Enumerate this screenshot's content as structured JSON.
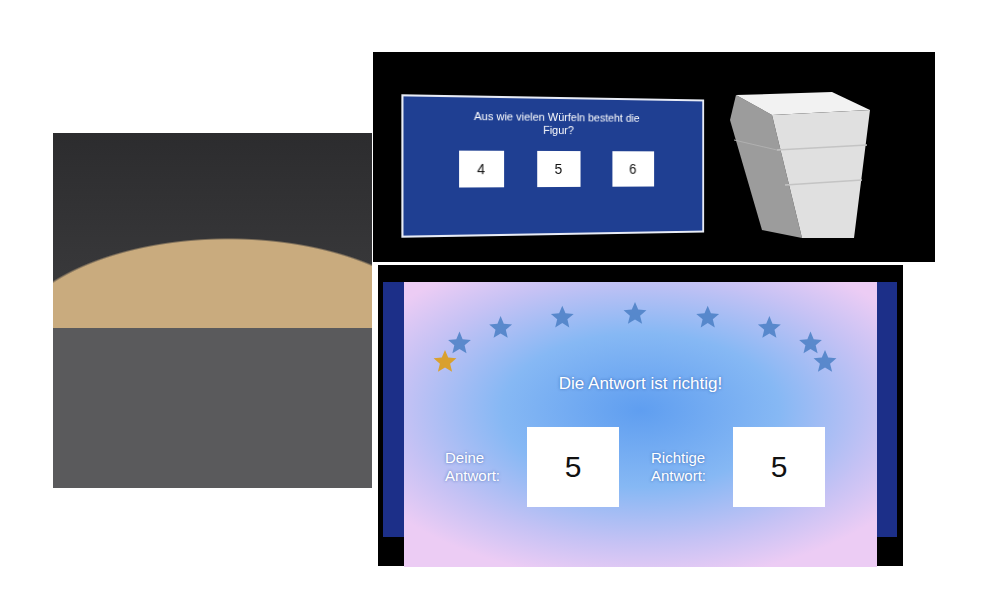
{
  "question_panel": {
    "title": "Aus wie vielen Würfeln besteht die Figur?",
    "options": [
      {
        "label": "4",
        "selected": false
      },
      {
        "label": "5",
        "selected": false
      },
      {
        "label": "6",
        "selected": false
      }
    ]
  },
  "result_panel": {
    "stars": 1,
    "star_total": 9,
    "message": "Die Antwort ist richtig!",
    "your_answer": {
      "label": "Deine Antwort:",
      "value": "5"
    },
    "correct_answer": {
      "label": "Richtige Antwort:",
      "value": "5"
    }
  }
}
